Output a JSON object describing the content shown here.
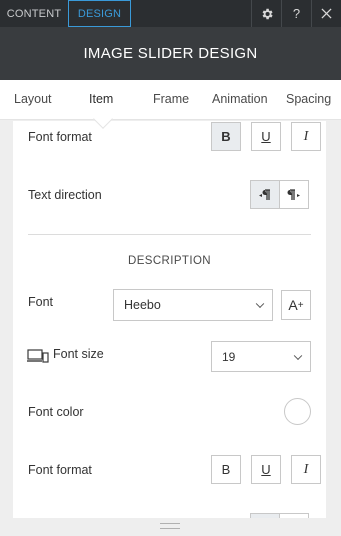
{
  "top_tabs": {
    "content": "CONTENT",
    "design": "DESIGN"
  },
  "top_buttons": {
    "settings_icon": "gear-icon",
    "help": "?",
    "close_icon": "close-icon"
  },
  "header": {
    "title": "IMAGE SLIDER DESIGN"
  },
  "sub_tabs": [
    "Layout",
    "Item",
    "Frame",
    "Animation",
    "Spacing"
  ],
  "active_sub_tab": "Item",
  "item_section": {
    "font_format_label": "Font format",
    "font_format_buttons": {
      "bold": "B",
      "underline": "U",
      "italic": "I"
    },
    "text_direction_label": "Text direction"
  },
  "description_section": {
    "title": "DESCRIPTION",
    "font_label": "Font",
    "font_value": "Heebo",
    "add_font": "A",
    "add_font_plus": "+",
    "font_size_label": "Font size",
    "font_size_value": "19",
    "font_color_label": "Font color",
    "font_color_value": "#ffffff",
    "font_format_label": "Font format",
    "font_format_buttons": {
      "bold": "B",
      "underline": "U",
      "italic": "I"
    }
  },
  "colors": {
    "accent": "#3a9ad9",
    "topbar": "#2b2e31",
    "header": "#393c3f"
  }
}
